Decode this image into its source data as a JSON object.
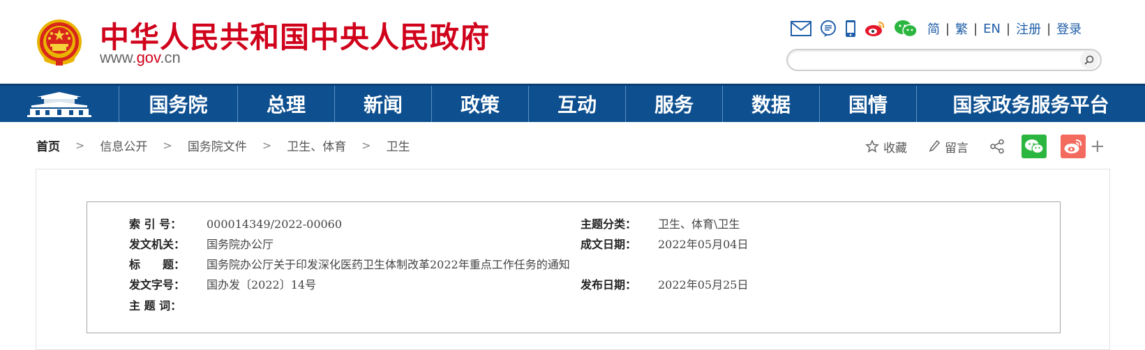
{
  "header": {
    "title": "中华人民共和国中央人民政府",
    "url_prefix": "www.",
    "url_gov": "gov",
    "url_suffix": ".cn"
  },
  "topbar": {
    "icons": [
      "mail-icon",
      "chat-bubble-icon",
      "mobile-icon",
      "weibo-icon",
      "wechat-icon"
    ],
    "languages": [
      "简",
      "繁",
      "EN"
    ],
    "register": "注册",
    "login": "登录",
    "separator": "|"
  },
  "search": {
    "placeholder": ""
  },
  "nav": {
    "items": [
      "国务院",
      "总理",
      "新闻",
      "政策",
      "互动",
      "服务",
      "数据",
      "国情",
      "国家政务服务平台"
    ]
  },
  "breadcrumb": {
    "items": [
      "首页",
      "信息公开",
      "国务院文件",
      "卫生、体育",
      "卫生"
    ],
    "separator": ">"
  },
  "share": {
    "favorite": "收藏",
    "comment": "留言",
    "plus": "+"
  },
  "meta": {
    "index_label": "索 引 号：",
    "index_value": "000014349/2022-00060",
    "topic_label": "主题分类：",
    "topic_value": "卫生、体育\\卫生",
    "issuer_label": "发文机关：",
    "issuer_value": "国务院办公厅",
    "written_label": "成文日期：",
    "written_value": "2022年05月04日",
    "title_label": "标　　题：",
    "title_value": "国务院办公厅关于印发深化医药卫生体制改革2022年重点工作任务的通知",
    "docno_label": "发文字号：",
    "docno_value": "国办发〔2022〕14号",
    "publish_label": "发布日期：",
    "publish_value": "2022年05月25日",
    "keyword_label": "主 题 词：",
    "keyword_value": ""
  },
  "colors": {
    "brand_red": "#d0021b",
    "nav_blue": "#0d4f8f",
    "link_blue": "#1f5ea8",
    "wechat_green": "#2bb63f",
    "weibo_red": "#f36a5f"
  }
}
